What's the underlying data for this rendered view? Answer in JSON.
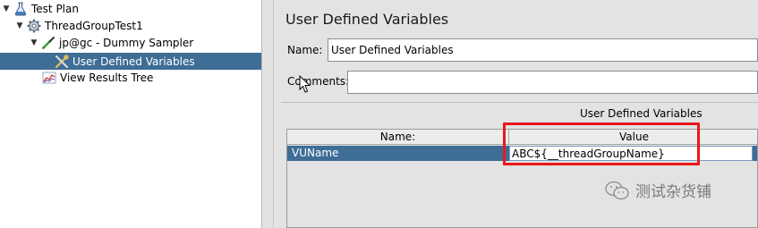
{
  "tree": {
    "items": [
      {
        "label": "Test Plan",
        "icon": "flask-icon",
        "expanded": true,
        "selected": false
      },
      {
        "label": "ThreadGroupTest1",
        "icon": "gear-icon",
        "expanded": true,
        "selected": false
      },
      {
        "label": "jp@gc - Dummy Sampler",
        "icon": "pipette-icon",
        "expanded": true,
        "selected": false
      },
      {
        "label": "User Defined Variables",
        "icon": "wrench-icon",
        "expanded": false,
        "selected": true
      },
      {
        "label": "View Results Tree",
        "icon": "chart-icon",
        "expanded": false,
        "selected": false
      }
    ]
  },
  "panel": {
    "title": "User Defined Variables",
    "name_label": "Name:",
    "name_value": "User Defined Variables",
    "comments_label": "Comments:",
    "comments_value": "",
    "table": {
      "caption": "User Defined Variables",
      "columns": [
        "Name:",
        "Value"
      ],
      "rows": [
        {
          "name": "VUName",
          "value": "ABC${__threadGroupName}"
        }
      ]
    }
  },
  "watermark": {
    "text": "测试杂货铺"
  },
  "colors": {
    "selection": "#3e6d96",
    "highlight_box": "#e8191d",
    "panel_bg": "#e3e3e3"
  }
}
